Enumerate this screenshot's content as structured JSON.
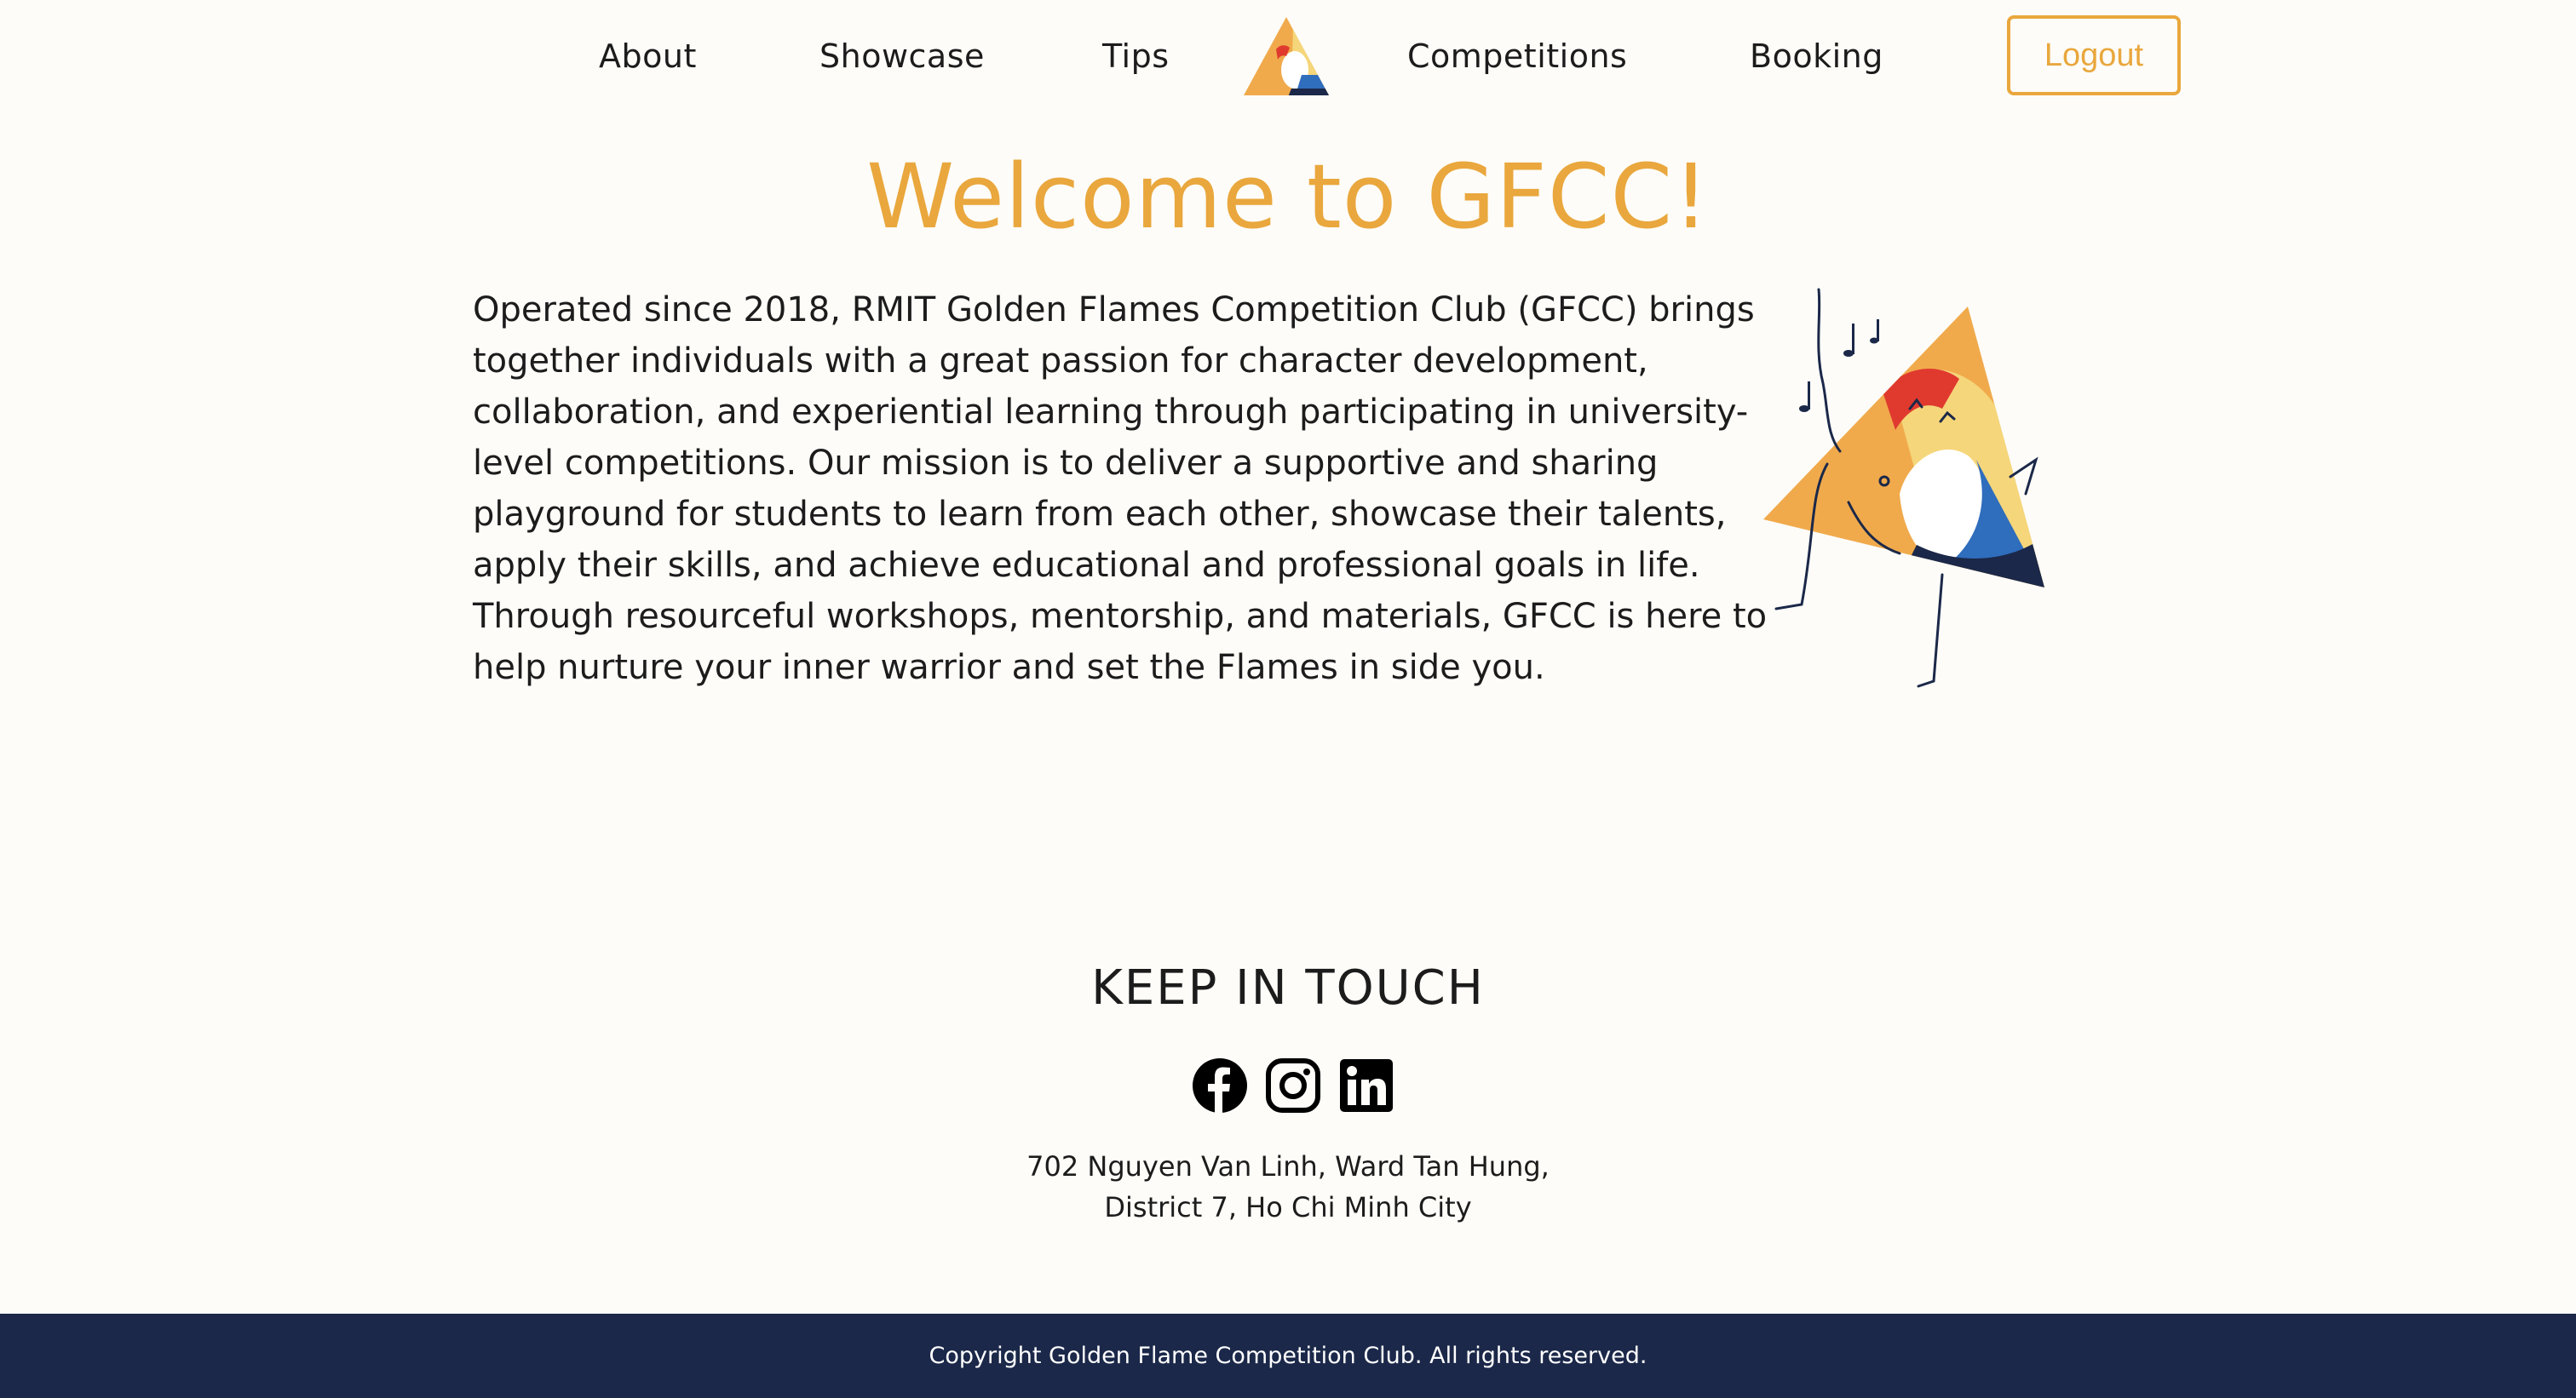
{
  "nav": {
    "items": [
      "About",
      "Showcase",
      "Tips",
      "Competitions",
      "Booking"
    ],
    "logout_label": "Logout"
  },
  "hero": {
    "title": "Welcome to GFCC!",
    "description": "Operated since 2018, RMIT Golden Flames Competition Club (GFCC) brings together individuals with a great passion for character development, collaboration, and experiential learning through participating in university-level competitions. Our mission is to deliver a supportive and sharing playground for students to learn from each other, showcase their talents, apply their skills, and achieve educational and professional goals in life. Through resourceful workshops, mentorship, and materials, GFCC is here to help nurture your inner warrior and set the Flames in side you."
  },
  "contact": {
    "title": "KEEP IN TOUCH",
    "socials": [
      "facebook-icon",
      "instagram-icon",
      "linkedin-icon"
    ],
    "address_line1": "702 Nguyen Van Linh, Ward Tan Hung,",
    "address_line2": "District 7, Ho Chi Minh City"
  },
  "footer": {
    "copyright": "Copyright Golden Flame Competition Club. All rights reserved."
  },
  "colors": {
    "accent": "#e9a73d",
    "footer_bg": "#1b2849",
    "page_bg": "#fdfcf8",
    "logo_red": "#e03a2f",
    "logo_blue": "#2f6dbd",
    "logo_yellow": "#f5d67a"
  }
}
